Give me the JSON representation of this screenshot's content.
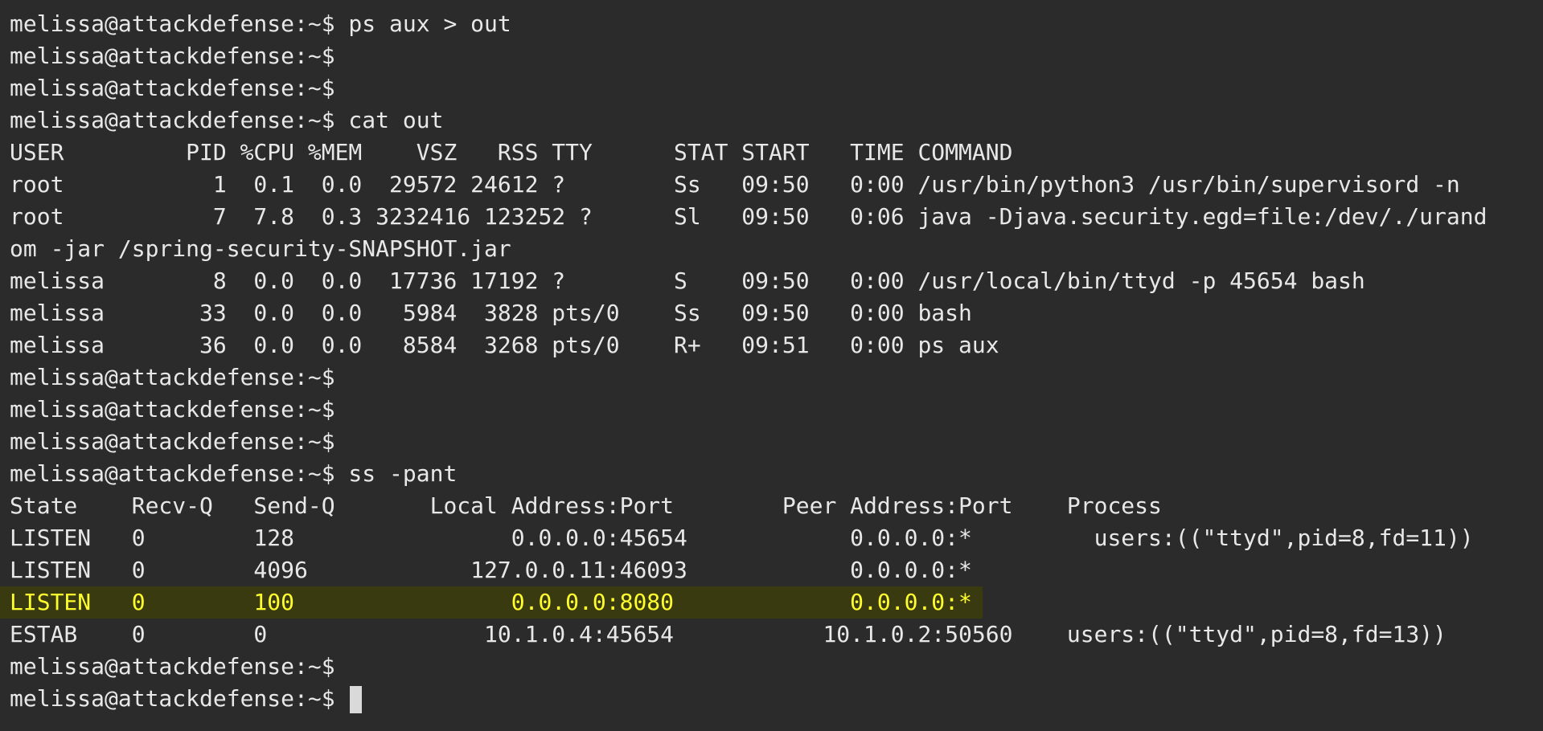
{
  "terminal": {
    "lines": [
      "melissa@attackdefense:~$ ps aux > out",
      "melissa@attackdefense:~$",
      "melissa@attackdefense:~$",
      "melissa@attackdefense:~$ cat out",
      "USER         PID %CPU %MEM    VSZ   RSS TTY      STAT START   TIME COMMAND",
      "root           1  0.1  0.0  29572 24612 ?        Ss   09:50   0:00 /usr/bin/python3 /usr/bin/supervisord -n",
      "root           7  7.8  0.3 3232416 123252 ?      Sl   09:50   0:06 java -Djava.security.egd=file:/dev/./urand",
      "om -jar /spring-security-SNAPSHOT.jar",
      "melissa        8  0.0  0.0  17736 17192 ?        S    09:50   0:00 /usr/local/bin/ttyd -p 45654 bash",
      "melissa       33  0.0  0.0   5984  3828 pts/0    Ss   09:50   0:00 bash",
      "melissa       36  0.0  0.0   8584  3268 pts/0    R+   09:51   0:00 ps aux",
      "melissa@attackdefense:~$",
      "melissa@attackdefense:~$",
      "melissa@attackdefense:~$",
      "melissa@attackdefense:~$ ss -pant",
      "State    Recv-Q   Send-Q       Local Address:Port        Peer Address:Port    Process",
      "LISTEN   0        128                0.0.0.0:45654            0.0.0.0:*         users:((\"ttyd\",pid=8,fd=11))",
      "LISTEN   0        4096            127.0.0.11:46093            0.0.0.0:*",
      "LISTEN   0        100                0.0.0.0:8080             0.0.0.0:*",
      "ESTAB    0        0                10.1.0.4:45654           10.1.0.2:50560    users:((\"ttyd\",pid=8,fd=13))",
      "melissa@attackdefense:~$",
      "melissa@attackdefense:~$ "
    ],
    "highlight_color": "#ffff2e"
  }
}
